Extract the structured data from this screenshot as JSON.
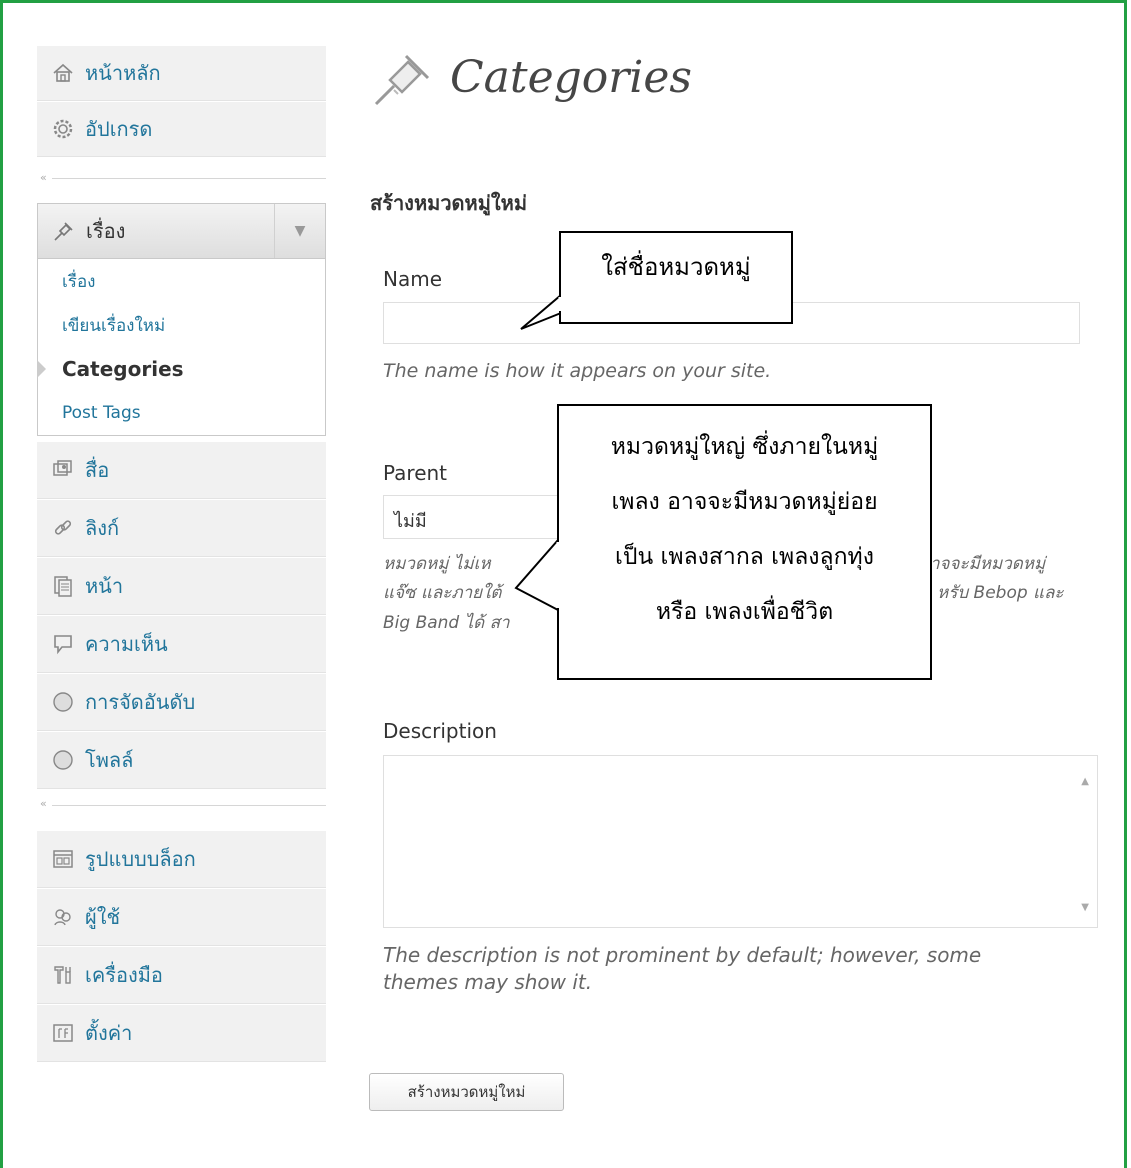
{
  "sidebar": {
    "top_items": [
      {
        "label": "หน้าหลัก",
        "icon": "home-icon"
      },
      {
        "label": "อัปเกรด",
        "icon": "upgrade-gear-icon"
      }
    ],
    "posts": {
      "label": "เรื่อง",
      "icon": "pushpin-icon",
      "submenu": [
        {
          "label": "เรื่อง",
          "current": false
        },
        {
          "label": "เขียนเรื่องใหม่",
          "current": false
        },
        {
          "label": "Categories",
          "current": true
        },
        {
          "label": "Post Tags",
          "current": false
        }
      ]
    },
    "middle_items": [
      {
        "label": "สื่อ",
        "icon": "media-icon"
      },
      {
        "label": "ลิงก์",
        "icon": "link-icon"
      },
      {
        "label": "หน้า",
        "icon": "page-icon"
      },
      {
        "label": "ความเห็น",
        "icon": "comment-icon"
      },
      {
        "label": "การจัดอันดับ",
        "icon": "ratings-icon"
      },
      {
        "label": "โพลล์",
        "icon": "polls-icon"
      }
    ],
    "bottom_items": [
      {
        "label": "รูปแบบบล็อก",
        "icon": "appearance-icon"
      },
      {
        "label": "ผู้ใช้",
        "icon": "users-icon"
      },
      {
        "label": "เครื่องมือ",
        "icon": "tools-icon"
      },
      {
        "label": "ตั้งค่า",
        "icon": "settings-icon"
      }
    ],
    "collapse_glyph": "«"
  },
  "main": {
    "title": "Categories",
    "form_heading": "สร้างหมวดหมู่ใหม่",
    "name_label": "Name",
    "name_value": "",
    "name_help": "The name is how it appears on your site.",
    "parent_label": "Parent",
    "parent_selected": "ไม่มี",
    "parent_help_line1": "หมวดหมู่ ไม่เห",
    "parent_help_line1_tail": "าจจะมีหมวดหมู่",
    "parent_help_line2": "แจ๊ซ และภายใต้",
    "parent_help_line2_tail": "หรับ Bebop และ",
    "parent_help_line3": "Big Band ได้ สา",
    "description_label": "Description",
    "description_value": "",
    "description_help_line1": "The description is not prominent by default; however, some",
    "description_help_line2": "themes may show it.",
    "submit_label": "สร้างหมวดหมู่ใหม่"
  },
  "callouts": {
    "name_callout": "ใส่ชื่อหมวดหมู่",
    "parent_callout_lines": [
      "หมวดหมู่ใหญ่ ซึ่งภายในหมู่",
      "เพลง อาจจะมีหมวดหมู่ย่อย",
      "เป็น เพลงสากล เพลงลูกทุ่ง",
      "หรือ เพลงเพื่อชีวิต"
    ]
  }
}
